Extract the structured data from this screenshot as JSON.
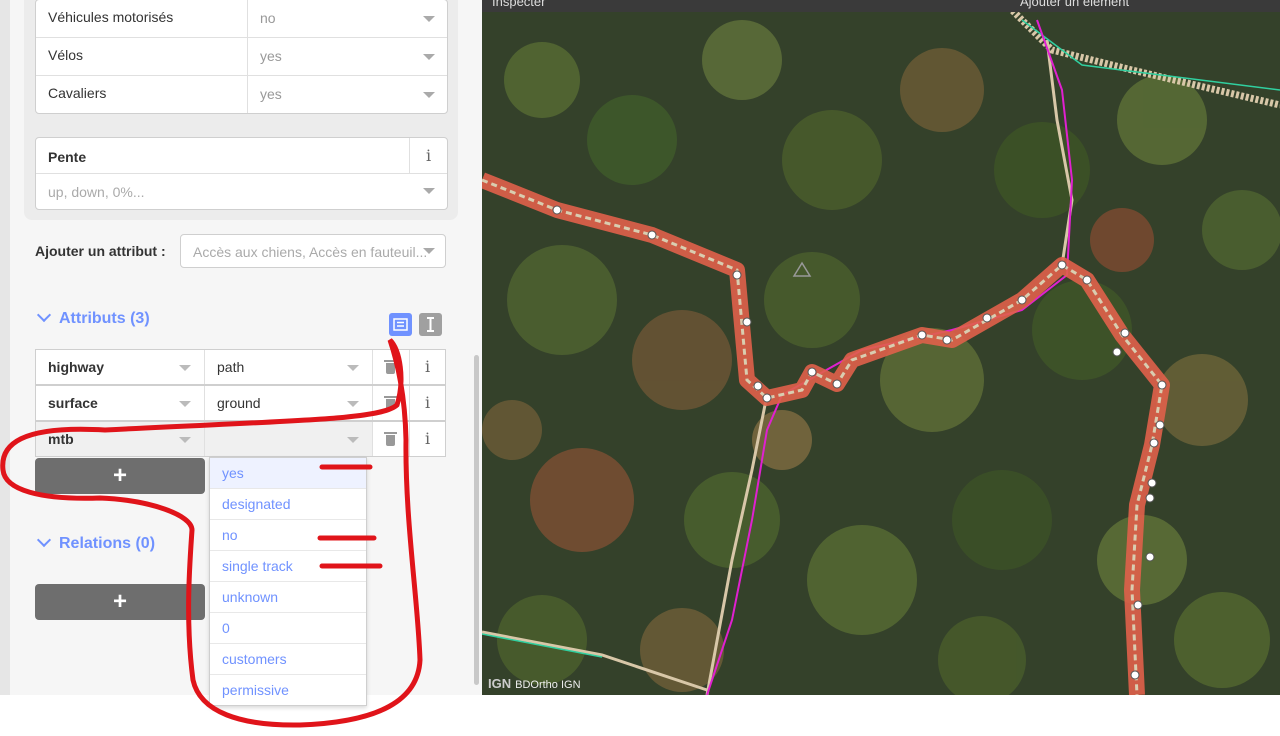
{
  "sidebar": {
    "access_rows": [
      {
        "label": "Véhicules motorisés",
        "value": "no"
      },
      {
        "label": "Vélos",
        "value": "yes"
      },
      {
        "label": "Cavaliers",
        "value": "yes"
      }
    ],
    "pente": {
      "label": "Pente",
      "placeholder": "up, down, 0%...",
      "info": "i"
    },
    "add_attribute": {
      "label": "Ajouter un attribut :",
      "placeholder": "Accès aux chiens, Accès en fauteuil..."
    },
    "attributes_section": {
      "title": "Attributs (3)"
    },
    "tags": [
      {
        "key": "highway",
        "value": "path"
      },
      {
        "key": "surface",
        "value": "ground"
      },
      {
        "key": "mtb",
        "value": ""
      }
    ],
    "add_tag_label": "+",
    "info_glyph": "i",
    "relations_section": {
      "title": "Relations (0)"
    },
    "add_relation_label": "+",
    "mtb_options": [
      "yes",
      "designated",
      "no",
      "single track",
      "unknown",
      "0",
      "customers",
      "permissive"
    ]
  },
  "map": {
    "top_left_label": "Inspecter",
    "top_right_label": "Ajouter un élément",
    "imagery_logo": "IGN",
    "imagery_name": "BDOrtho IGN"
  },
  "colors": {
    "accent": "#7092ff",
    "annotation_red": "#e0141a",
    "selected_way": "#e0604a",
    "magenta_route": "#e020d0"
  }
}
